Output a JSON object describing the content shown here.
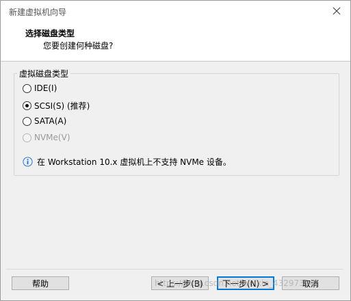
{
  "window": {
    "title": "新建虚拟机向导"
  },
  "header": {
    "title": "选择磁盘类型",
    "subtitle": "您要创建何种磁盘?"
  },
  "group": {
    "label": "虚拟磁盘类型",
    "options": [
      {
        "label": "IDE(I)",
        "checked": false,
        "disabled": false
      },
      {
        "label": "SCSI(S) (推荐)",
        "checked": true,
        "disabled": false
      },
      {
        "label": "SATA(A)",
        "checked": false,
        "disabled": false
      },
      {
        "label": "NVMe(V)",
        "checked": false,
        "disabled": true
      }
    ],
    "info_text": "在 Workstation 10.x 虚拟机上不支持 NVMe 设备。"
  },
  "buttons": {
    "help": "帮助",
    "back": "< 上一步(B)",
    "next": "下一步(N) >",
    "cancel": "取消"
  },
  "watermark": "https://blog.csdn.net/weixin_43297396",
  "colors": {
    "accent": "#0078d7",
    "info_icon": "#2a6ebb"
  }
}
